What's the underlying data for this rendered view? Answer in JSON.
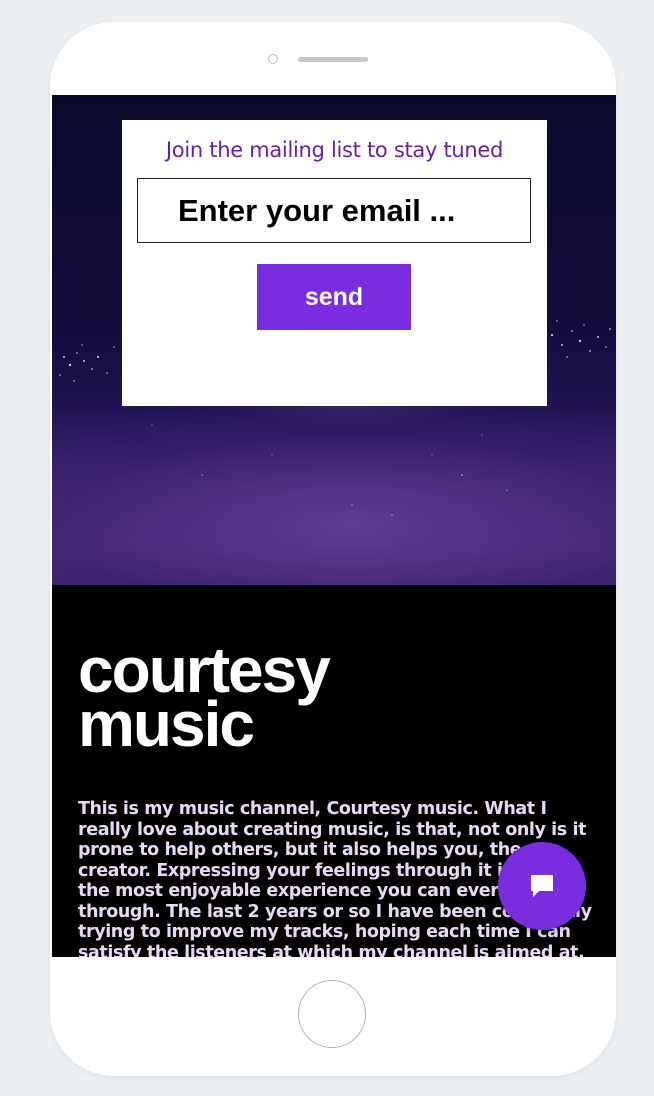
{
  "mailing_list": {
    "heading": "Join the mailing list to stay tuned",
    "email_placeholder": "Enter your email ...",
    "send_label": "send"
  },
  "main": {
    "title_line1": "courtesy",
    "title_line2": "music",
    "body": "This is my music channel, Courtesy music. What I really love about creating music, is that, not only is it prone to help others, but it also helps you, the creator. Expressing your feelings through it is one of the most enjoyable experience you can ever go through. The last 2 years or so I have been constantly trying to improve my tracks, hoping each time I can satisfy the listeners at which my channel is aimed at. Welcome to my page. Thanks for listening"
  },
  "chat": {
    "icon": "chat-bubble-icon"
  },
  "colors": {
    "accent": "#7a2de0",
    "heading_purple": "#6a1fa3",
    "hero_dark": "#0b0a2c",
    "hero_purple": "#4a2c80",
    "body_text": "#e7d8f5",
    "background": "#000000"
  }
}
